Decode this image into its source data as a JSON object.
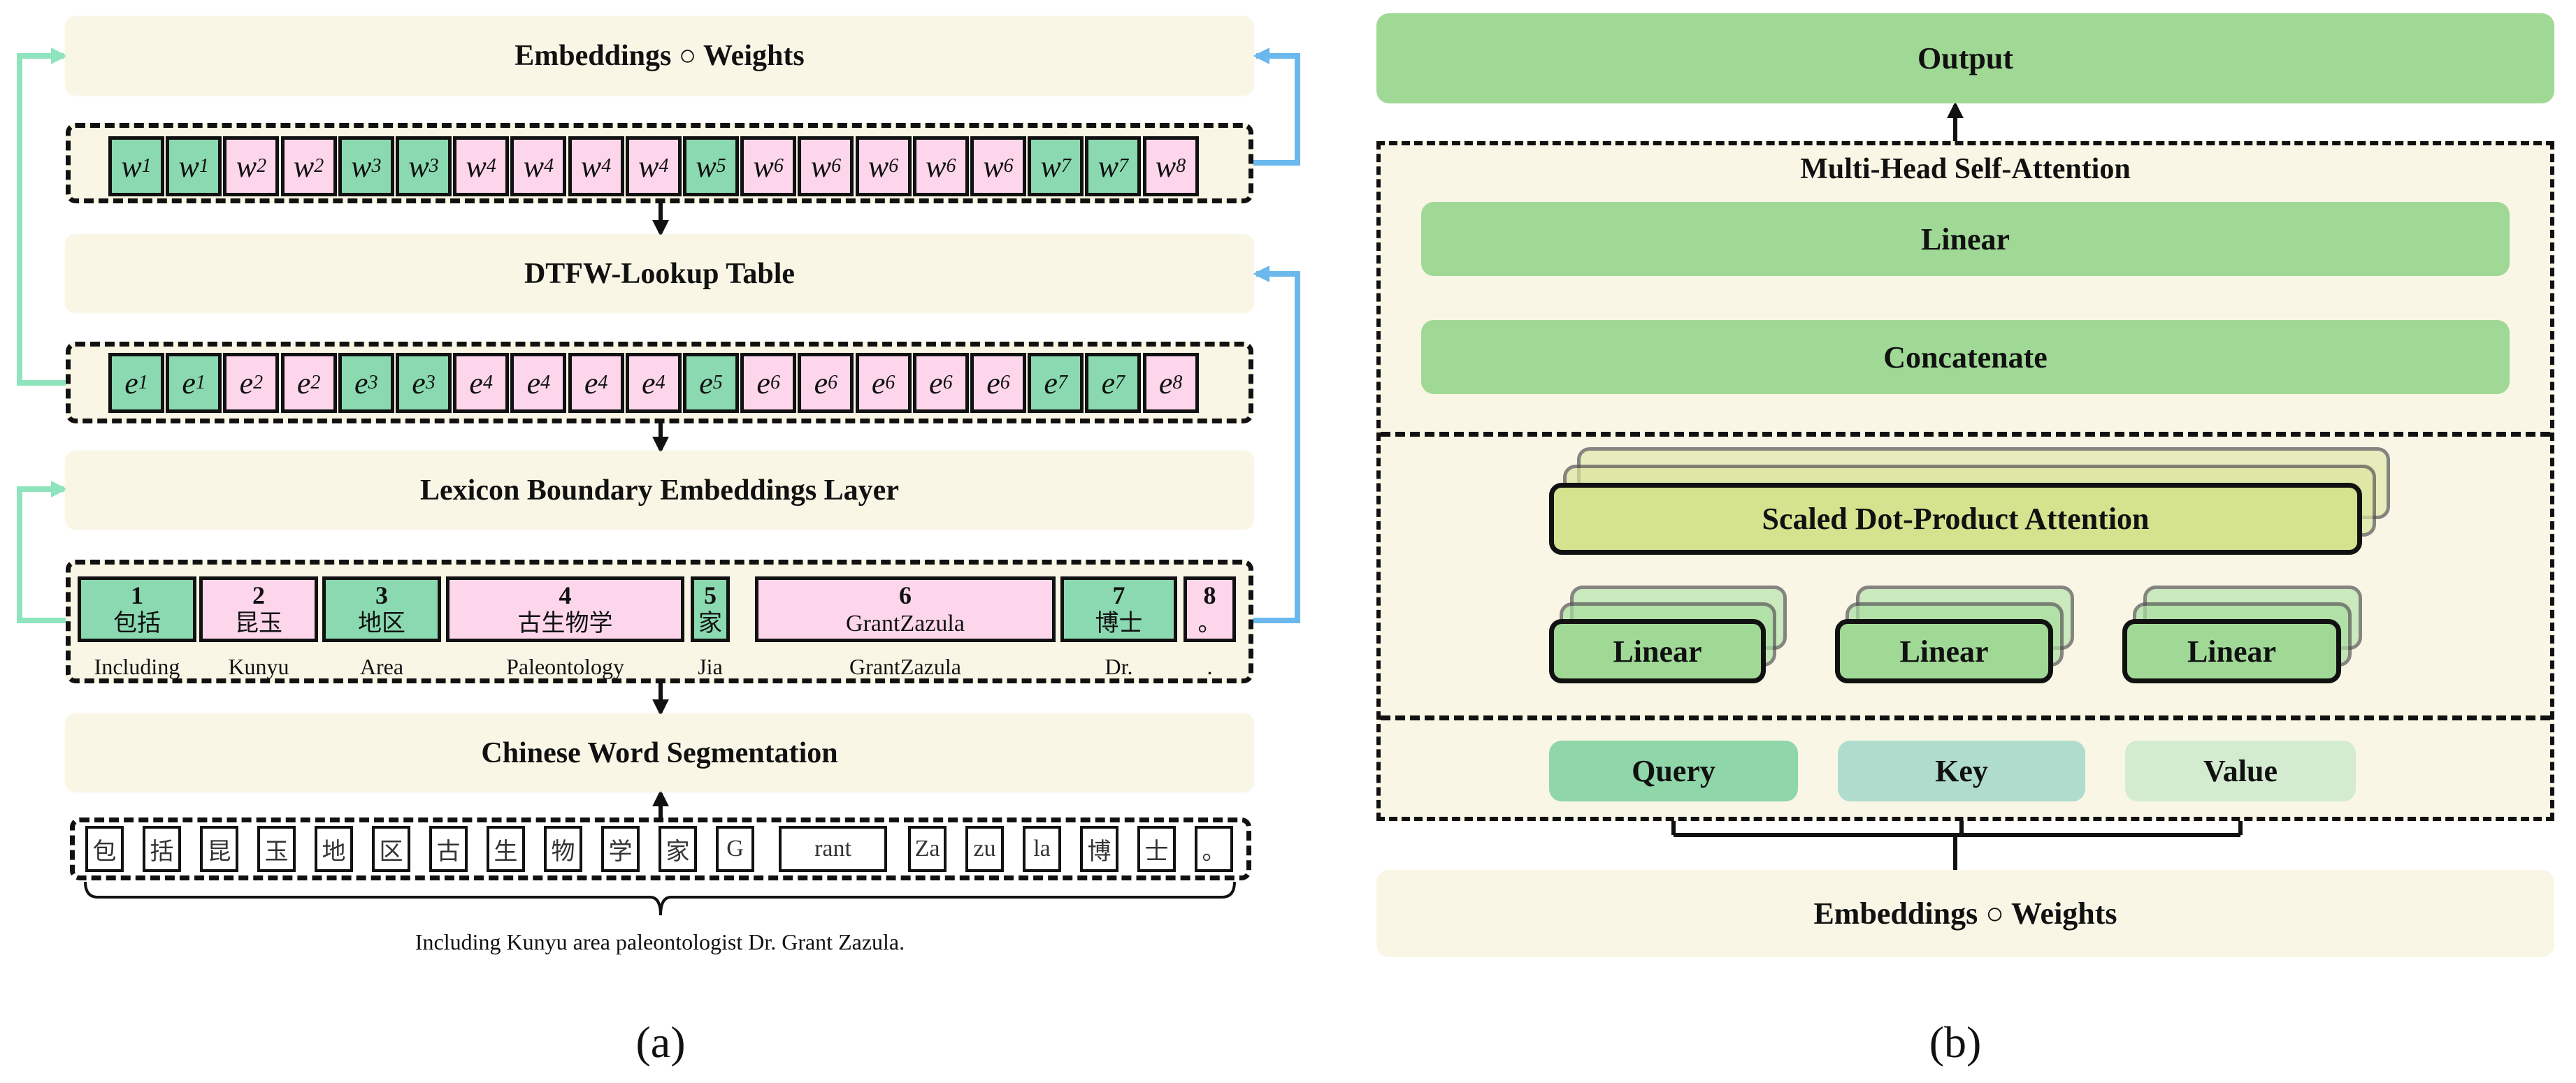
{
  "panel_a": {
    "label": "(a)",
    "embeddings_weights": "Embeddings ○ Weights",
    "dtfw_lookup": "DTFW-Lookup Table",
    "lexicon_layer": "Lexicon Boundary Embeddings Layer",
    "cws": "Chinese Word Segmentation",
    "w_row": [
      {
        "v": "w",
        "s": "1",
        "t": "g"
      },
      {
        "v": "w",
        "s": "1",
        "t": "g"
      },
      {
        "v": "w",
        "s": "2",
        "t": "p"
      },
      {
        "v": "w",
        "s": "2",
        "t": "p"
      },
      {
        "v": "w",
        "s": "3",
        "t": "g"
      },
      {
        "v": "w",
        "s": "3",
        "t": "g"
      },
      {
        "v": "w",
        "s": "4",
        "t": "p"
      },
      {
        "v": "w",
        "s": "4",
        "t": "p"
      },
      {
        "v": "w",
        "s": "4",
        "t": "p"
      },
      {
        "v": "w",
        "s": "4",
        "t": "p"
      },
      {
        "v": "w",
        "s": "5",
        "t": "g"
      },
      {
        "v": "w",
        "s": "6",
        "t": "p"
      },
      {
        "v": "w",
        "s": "6",
        "t": "p"
      },
      {
        "v": "w",
        "s": "6",
        "t": "p"
      },
      {
        "v": "w",
        "s": "6",
        "t": "p"
      },
      {
        "v": "w",
        "s": "6",
        "t": "p"
      },
      {
        "v": "w",
        "s": "7",
        "t": "g"
      },
      {
        "v": "w",
        "s": "7",
        "t": "g"
      },
      {
        "v": "w",
        "s": "8",
        "t": "p"
      }
    ],
    "e_row": [
      {
        "v": "e",
        "s": "1",
        "t": "g"
      },
      {
        "v": "e",
        "s": "1",
        "t": "g"
      },
      {
        "v": "e",
        "s": "2",
        "t": "p"
      },
      {
        "v": "e",
        "s": "2",
        "t": "p"
      },
      {
        "v": "e",
        "s": "3",
        "t": "g"
      },
      {
        "v": "e",
        "s": "3",
        "t": "g"
      },
      {
        "v": "e",
        "s": "4",
        "t": "p"
      },
      {
        "v": "e",
        "s": "4",
        "t": "p"
      },
      {
        "v": "e",
        "s": "4",
        "t": "p"
      },
      {
        "v": "e",
        "s": "4",
        "t": "p"
      },
      {
        "v": "e",
        "s": "5",
        "t": "g"
      },
      {
        "v": "e",
        "s": "6",
        "t": "p"
      },
      {
        "v": "e",
        "s": "6",
        "t": "p"
      },
      {
        "v": "e",
        "s": "6",
        "t": "p"
      },
      {
        "v": "e",
        "s": "6",
        "t": "p"
      },
      {
        "v": "e",
        "s": "6",
        "t": "p"
      },
      {
        "v": "e",
        "s": "7",
        "t": "g"
      },
      {
        "v": "e",
        "s": "7",
        "t": "g"
      },
      {
        "v": "e",
        "s": "8",
        "t": "p"
      }
    ],
    "segments": [
      {
        "num": "1",
        "word": "包括",
        "gloss": "Including",
        "t": "g"
      },
      {
        "num": "2",
        "word": "昆玉",
        "gloss": "Kunyu",
        "t": "p"
      },
      {
        "num": "3",
        "word": "地区",
        "gloss": "Area",
        "t": "g"
      },
      {
        "num": "4",
        "word": "古生物学",
        "gloss": "Paleontology",
        "t": "p"
      },
      {
        "num": "5",
        "word": "家",
        "gloss": "Jia",
        "t": "g"
      },
      {
        "num": "6",
        "word": "GrantZazula",
        "gloss": "GrantZazula",
        "t": "p"
      },
      {
        "num": "7",
        "word": "博士",
        "gloss": "Dr.",
        "t": "g"
      },
      {
        "num": "8",
        "word": "。",
        "gloss": ".",
        "t": "p"
      }
    ],
    "characters": [
      "包",
      "括",
      "昆",
      "玉",
      "地",
      "区",
      "古",
      "生",
      "物",
      "学",
      "家",
      "G",
      "rant",
      "Za",
      "zu",
      "la",
      "博",
      "士",
      "。"
    ],
    "caption": "Including Kunyu area paleontologist Dr. Grant Zazula."
  },
  "panel_b": {
    "label": "(b)",
    "output": "Output",
    "mhsa_title": "Multi-Head Self-Attention",
    "linear_top": "Linear",
    "concatenate": "Concatenate",
    "sdpa": "Scaled Dot-Product Attention",
    "linears": [
      "Linear",
      "Linear",
      "Linear"
    ],
    "query": "Query",
    "key": "Key",
    "value": "Value",
    "embeddings_weights": "Embeddings ○ Weights"
  },
  "colors": {
    "cell_green": "#8ad9b1",
    "cell_pink": "#fdd6ec",
    "cream": "#f9f6e6",
    "skip_green": "#8fe3bd",
    "skip_blue": "#6ab8ec",
    "block_green": "#a0d996",
    "sdpa": "#d5e38f",
    "query": "#8fd6a9",
    "key": "#b0dccd",
    "value": "#d3ecd0"
  }
}
